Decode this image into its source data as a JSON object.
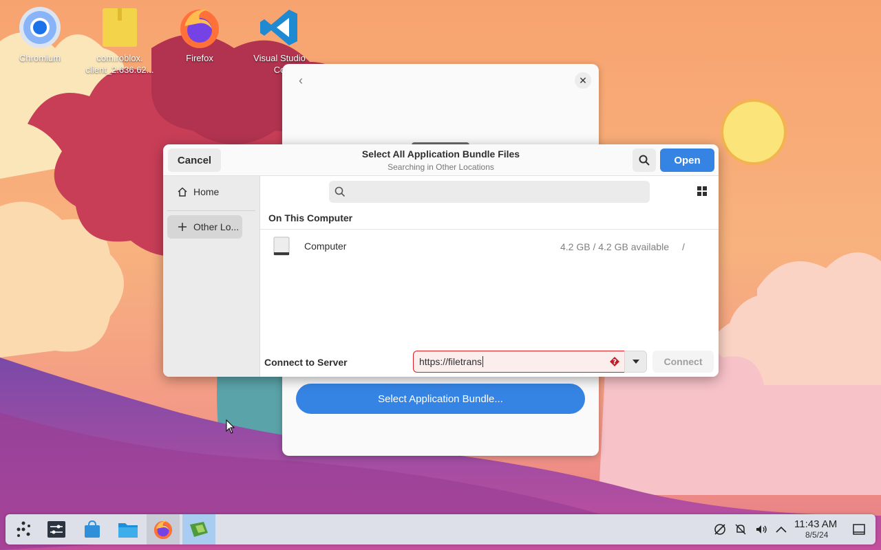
{
  "desktop": {
    "icons": [
      {
        "label": "Chromium",
        "icon": "chromium-icon"
      },
      {
        "label": "com.roblox.\nclient_2.636.62...",
        "icon": "archive-file-icon"
      },
      {
        "label": "Firefox",
        "icon": "firefox-icon"
      },
      {
        "label": "Visual Studio\nCo",
        "icon": "vscode-icon"
      }
    ]
  },
  "bg_window": {
    "select_button": "Select Application Bundle..."
  },
  "dialog": {
    "cancel": "Cancel",
    "title": "Select All Application Bundle Files",
    "subtitle": "Searching in Other Locations",
    "open": "Open",
    "sidebar": {
      "home": "Home",
      "other_locations": "Other Lo..."
    },
    "section_title": "On This Computer",
    "location": {
      "name": "Computer",
      "available": "4.2 GB / 4.2 GB available",
      "mount": "/"
    },
    "server": {
      "label": "Connect to Server",
      "value": "https://filetrans",
      "connect": "Connect"
    }
  },
  "taskbar": {
    "time": "11:43 AM",
    "date": "8/5/24"
  },
  "colors": {
    "accent": "#3584e4",
    "error": "#e01b24"
  }
}
